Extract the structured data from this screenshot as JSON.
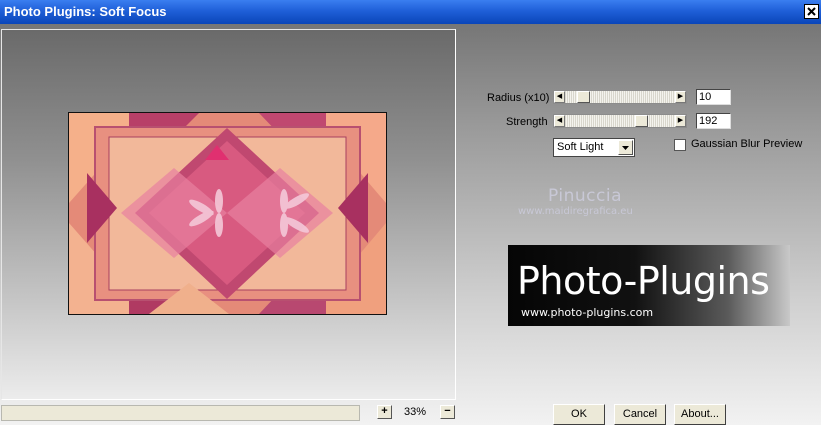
{
  "window": {
    "title": "Photo Plugins: Soft Focus"
  },
  "controls": {
    "radius": {
      "label": "Radius (x10)",
      "value": "10",
      "slider_fraction": 0.12
    },
    "strength": {
      "label": "Strength",
      "value": "192",
      "slider_fraction": 0.72
    },
    "blend_mode": {
      "selected": "Soft Light"
    },
    "gaussian": {
      "label": "Gaussian Blur Preview",
      "checked": false
    }
  },
  "zoom": {
    "plus": "+",
    "minus": "−",
    "value": "33%"
  },
  "watermark": {
    "name": "Pinuccia",
    "url": "www.maidiregrafica.eu"
  },
  "logo": {
    "title": "Photo-Plugins",
    "url": "www.photo-plugins.com"
  },
  "buttons": {
    "ok": "OK",
    "cancel": "Cancel",
    "about": "About..."
  },
  "colors": {
    "titlebar": "#0a45b8",
    "preview_pink": "#c85a78",
    "preview_peach": "#f5b08a",
    "preview_magenta": "#a8305a"
  }
}
